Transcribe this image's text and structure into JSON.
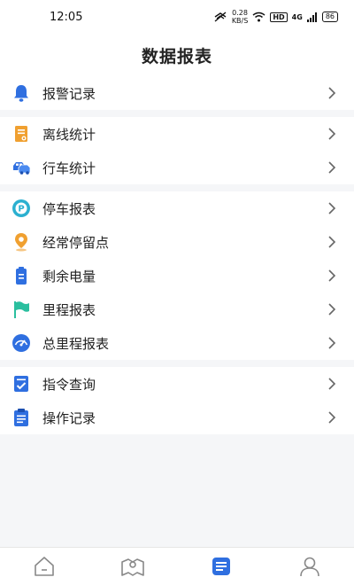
{
  "status": {
    "time": "12:05",
    "speed_value": "0.28",
    "speed_unit": "KB/S",
    "hd": "HD",
    "signal_label": "4G",
    "battery": "86"
  },
  "header": {
    "title": "数据报表"
  },
  "groups": [
    {
      "items": [
        {
          "label": "报警记录",
          "icon": "bell-icon"
        }
      ]
    },
    {
      "items": [
        {
          "label": "离线统计",
          "icon": "document-icon"
        },
        {
          "label": "行车统计",
          "icon": "car-icon"
        }
      ]
    },
    {
      "items": [
        {
          "label": "停车报表",
          "icon": "parking-icon"
        },
        {
          "label": "经常停留点",
          "icon": "location-pin-icon"
        },
        {
          "label": "剩余电量",
          "icon": "battery-icon"
        },
        {
          "label": "里程报表",
          "icon": "flag-icon"
        },
        {
          "label": "总里程报表",
          "icon": "speedometer-icon"
        }
      ]
    },
    {
      "items": [
        {
          "label": "指令查询",
          "icon": "checklist-icon"
        },
        {
          "label": "操作记录",
          "icon": "clipboard-icon"
        }
      ]
    }
  ],
  "tabs": [
    {
      "icon": "home-icon",
      "active": false
    },
    {
      "icon": "map-icon",
      "active": false
    },
    {
      "icon": "report-icon",
      "active": true
    },
    {
      "icon": "profile-icon",
      "active": false
    }
  ],
  "colors": {
    "accent": "#2f6fe0",
    "orange": "#f0a030",
    "teal": "#2bbf9f",
    "tab_inactive": "#888888"
  }
}
